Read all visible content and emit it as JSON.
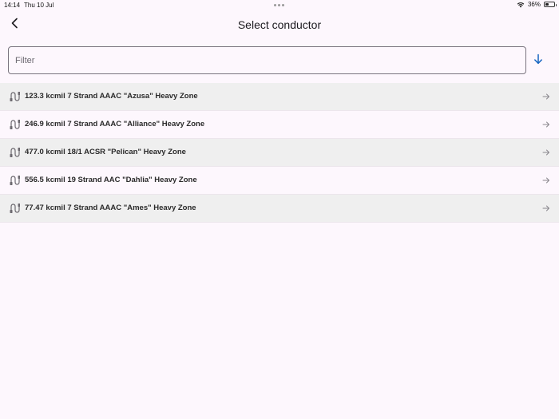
{
  "status_bar": {
    "time": "14:14",
    "date": "Thu 10 Jul",
    "battery_percent": "36%",
    "battery_level": 0.36
  },
  "header": {
    "title": "Select conductor",
    "back_icon": "chevron-left-icon"
  },
  "filter": {
    "placeholder": "Filter",
    "value": "",
    "sort_icon": "arrow-down-icon"
  },
  "conductors": [
    {
      "label": "123.3 kcmil 7 Strand AAAC \"Azusa\" Heavy Zone"
    },
    {
      "label": "246.9 kcmil 7 Strand AAAC \"Alliance\" Heavy Zone"
    },
    {
      "label": "477.0 kcmil 18/1 ACSR \"Pelican\" Heavy Zone"
    },
    {
      "label": "556.5 kcmil 19 Strand AAC \"Dahlia\" Heavy Zone"
    },
    {
      "label": "77.47 kcmil 7 Strand AAAC \"Ames\" Heavy Zone"
    }
  ],
  "colors": {
    "background": "#fdf7fd",
    "row_shaded": "#efefef",
    "sort_icon": "#1565c0"
  }
}
